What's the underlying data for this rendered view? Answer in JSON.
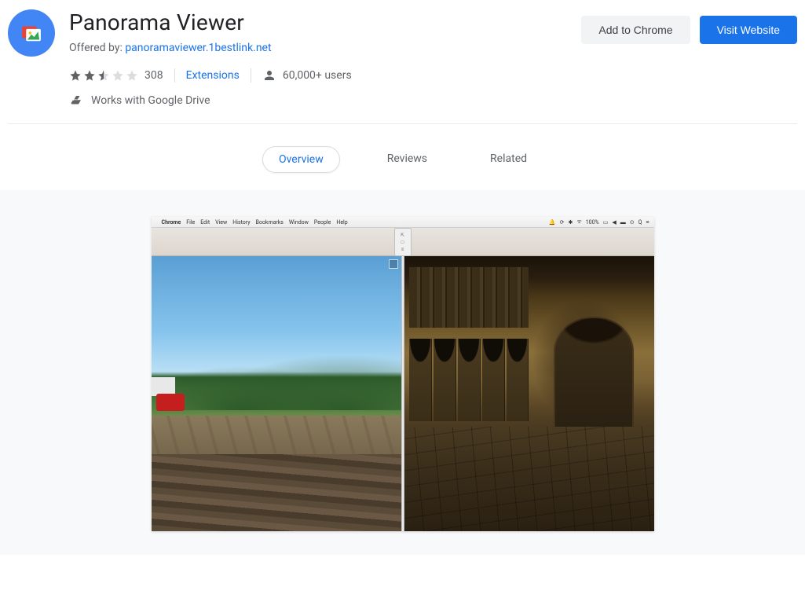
{
  "title": "Panorama Viewer",
  "offered_by_label": "Offered by: ",
  "offered_by_link": "panoramaviewer.1bestlink.net",
  "rating": {
    "value": 2.5,
    "count": "308"
  },
  "category": "Extensions",
  "users": "60,000+ users",
  "drive_label": "Works with Google Drive",
  "actions": {
    "add": "Add to Chrome",
    "visit": "Visit Website"
  },
  "tabs": {
    "overview": "Overview",
    "reviews": "Reviews",
    "related": "Related"
  },
  "menubar": {
    "app": "Chrome",
    "items": [
      "File",
      "Edit",
      "View",
      "History",
      "Bookmarks",
      "Window",
      "People",
      "Help"
    ],
    "status": "100%"
  }
}
